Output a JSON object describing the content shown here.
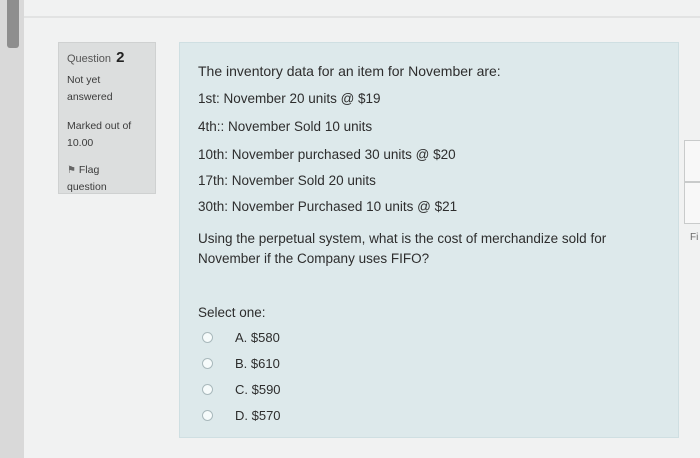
{
  "info": {
    "question_label": "Question",
    "question_number": "2",
    "state": [
      "Not yet",
      "answered"
    ],
    "grade": [
      "Marked out of",
      "10.00"
    ],
    "flag_label": [
      "Flag",
      "question"
    ],
    "flag_icon": "flag-icon"
  },
  "question": {
    "intro": "The inventory data for an item for November are:",
    "lines": [
      "1st: November 20 units @ $19",
      "4th:: November Sold 10 units",
      "10th: November purchased 30 units @ $20",
      "17th: November Sold 20 units",
      "30th: November Purchased 10 units @ $21"
    ],
    "text": "Using the perpetual system, what is the cost of merchandize sold for November if the Company uses FIFO?",
    "prompt": "Select one:",
    "options": [
      "A. $580",
      "B. $610",
      "C. $590",
      "D. $570"
    ],
    "selected": null
  },
  "side": {
    "fragment": "Fi"
  }
}
